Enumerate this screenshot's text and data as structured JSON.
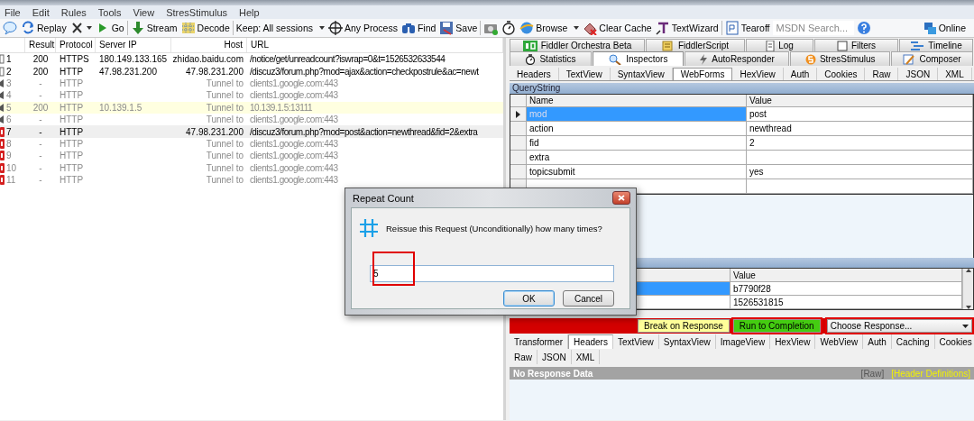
{
  "menu": [
    "File",
    "Edit",
    "Rules",
    "Tools",
    "View",
    "StresStimulus",
    "Help"
  ],
  "toolbar": [
    {
      "kind": "icon"
    },
    {
      "kind": "button",
      "label": "Replay"
    },
    {
      "kind": "icon-menu"
    },
    {
      "kind": "button",
      "label": "Go"
    },
    {
      "kind": "sep"
    },
    {
      "kind": "button",
      "label": "Stream"
    },
    {
      "kind": "button",
      "label": "Decode"
    },
    {
      "kind": "sep"
    },
    {
      "kind": "text-menu",
      "label": "Keep: All sessions"
    },
    {
      "kind": "button",
      "label": "Any Process"
    },
    {
      "kind": "button",
      "label": "Find"
    },
    {
      "kind": "button",
      "label": "Save"
    },
    {
      "kind": "sep"
    },
    {
      "kind": "icon"
    },
    {
      "kind": "icon"
    },
    {
      "kind": "menu",
      "label": "Browse"
    },
    {
      "kind": "button",
      "label": "Clear Cache"
    },
    {
      "kind": "button",
      "label": "TextWizard"
    },
    {
      "kind": "sep"
    },
    {
      "kind": "button",
      "label": "Tearoff"
    },
    {
      "kind": "search",
      "placeholder": "MSDN Search..."
    },
    {
      "kind": "icon"
    },
    {
      "kind": "status",
      "label": "Online"
    }
  ],
  "sessions": {
    "columns": [
      "Result",
      "Protocol",
      "Server IP",
      "Host",
      "URL"
    ],
    "rows": [
      {
        "num": "1",
        "result": "200",
        "protocol": "HTTPS",
        "server_ip": "180.149.133.165",
        "host": "zhidao.baidu.com",
        "url": "/notice/get/unreadcount?iswrap=0&t=1526532633544",
        "kind": "request",
        "breakpoint": false,
        "highlighted": false,
        "selected": false
      },
      {
        "num": "2",
        "result": "200",
        "protocol": "HTTP",
        "server_ip": "47.98.231.200",
        "host": "47.98.231.200",
        "url": "/discuz3/forum.php?mod=ajax&action=checkpostrule&ac=newt",
        "kind": "request",
        "breakpoint": false,
        "highlighted": false,
        "selected": false
      },
      {
        "num": "3",
        "result": "-",
        "protocol": "HTTP",
        "host": "Tunnel to",
        "url": "clients1.google.com:443",
        "kind": "tunnel",
        "breakpoint": false,
        "highlighted": false,
        "selected": false
      },
      {
        "num": "4",
        "result": "-",
        "protocol": "HTTP",
        "host": "Tunnel to",
        "url": "clients1.google.com:443",
        "kind": "tunnel",
        "breakpoint": false,
        "highlighted": false,
        "selected": false
      },
      {
        "num": "5",
        "result": "200",
        "protocol": "HTTP",
        "server_ip": "10.139.1.5",
        "host": "Tunnel to",
        "url": "10.139.1.5:13111",
        "kind": "tunnel",
        "breakpoint": false,
        "highlighted": true,
        "selected": false
      },
      {
        "num": "6",
        "result": "-",
        "protocol": "HTTP",
        "host": "Tunnel to",
        "url": "clients1.google.com:443",
        "kind": "tunnel",
        "breakpoint": false,
        "highlighted": false,
        "selected": false
      },
      {
        "num": "7",
        "result": "-",
        "protocol": "HTTP",
        "host": "47.98.231.200",
        "url": "/discuz3/forum.php?mod=post&action=newthread&fid=2&extra",
        "kind": "request",
        "breakpoint": true,
        "highlighted": false,
        "selected": true
      },
      {
        "num": "8",
        "result": "-",
        "protocol": "HTTP",
        "host": "Tunnel to",
        "url": "clients1.google.com:443",
        "kind": "tunnel",
        "breakpoint": true,
        "highlighted": false,
        "selected": false
      },
      {
        "num": "9",
        "result": "-",
        "protocol": "HTTP",
        "host": "Tunnel to",
        "url": "clients1.google.com:443",
        "kind": "tunnel",
        "breakpoint": true,
        "highlighted": false,
        "selected": false
      },
      {
        "num": "10",
        "result": "-",
        "protocol": "HTTP",
        "host": "Tunnel to",
        "url": "clients1.google.com:443",
        "kind": "tunnel",
        "breakpoint": true,
        "highlighted": false,
        "selected": false
      },
      {
        "num": "11",
        "result": "-",
        "protocol": "HTTP",
        "host": "Tunnel to",
        "url": "clients1.google.com:443",
        "kind": "tunnel",
        "breakpoint": true,
        "highlighted": false,
        "selected": false
      }
    ]
  },
  "right_tabs": [
    [
      {
        "label": "Fiddler Orchestra Beta",
        "selected": false
      },
      {
        "label": "FiddlerScript",
        "selected": false
      },
      {
        "label": "Log",
        "selected": false
      },
      {
        "label": "Filters",
        "selected": false
      },
      {
        "label": "Timeline",
        "selected": false
      }
    ],
    [
      {
        "label": "Statistics",
        "selected": false
      },
      {
        "label": "Inspectors",
        "selected": true
      },
      {
        "label": "AutoResponder",
        "selected": false
      },
      {
        "label": "StresStimulus",
        "selected": false
      },
      {
        "label": "Composer",
        "selected": false
      }
    ]
  ],
  "request_tabs": [
    {
      "label": "Headers",
      "selected": false
    },
    {
      "label": "TextView",
      "selected": false
    },
    {
      "label": "SyntaxView",
      "selected": false
    },
    {
      "label": "WebForms",
      "selected": true
    },
    {
      "label": "HexView",
      "selected": false
    },
    {
      "label": "Auth",
      "selected": false
    },
    {
      "label": "Cookies",
      "selected": false
    },
    {
      "label": "Raw",
      "selected": false
    },
    {
      "label": "JSON",
      "selected": false
    },
    {
      "label": "XML",
      "selected": false
    }
  ],
  "query_string": {
    "title": "QueryString",
    "columns": [
      "Name",
      "Value"
    ],
    "rows": [
      {
        "name": "mod",
        "value": "post",
        "selected": true
      },
      {
        "name": "action",
        "value": "newthread",
        "selected": false
      },
      {
        "name": "fid",
        "value": "2",
        "selected": false
      },
      {
        "name": "extra",
        "selected": false
      },
      {
        "name": "topicsubmit",
        "value": "yes",
        "selected": false
      }
    ]
  },
  "body_grid": {
    "columns": [
      "Value"
    ],
    "rows": [
      {
        "value": "b7790f28",
        "selected": true
      },
      {
        "value": "1526531815",
        "selected": false
      }
    ]
  },
  "breakpoint_bar": {
    "buttons": [
      {
        "label": "Break on Response",
        "kind": "break",
        "outlined": false
      },
      {
        "label": "Run to Completion",
        "kind": "run",
        "outlined": true
      }
    ],
    "dropdown": {
      "label": "Choose Response...",
      "outlined": true
    }
  },
  "response_tabs": [
    [
      {
        "label": "Transformer",
        "selected": false
      },
      {
        "label": "Headers",
        "selected": true
      },
      {
        "label": "TextView",
        "selected": false
      },
      {
        "label": "SyntaxView",
        "selected": false
      },
      {
        "label": "ImageView",
        "selected": false
      },
      {
        "label": "HexView",
        "selected": false
      },
      {
        "label": "WebView",
        "selected": false
      },
      {
        "label": "Auth",
        "selected": false
      },
      {
        "label": "Caching",
        "selected": false
      },
      {
        "label": "Cookies",
        "selected": false
      }
    ],
    [
      {
        "label": "Raw",
        "selected": false
      },
      {
        "label": "JSON",
        "selected": false
      },
      {
        "label": "XML",
        "selected": false
      }
    ]
  ],
  "response_bar": {
    "title": "No Response Data",
    "links": [
      "[Raw]",
      "[Header Definitions]"
    ]
  },
  "dialog": {
    "title": "Repeat Count",
    "message": "Reissue this Request (Unconditionally) how many times?",
    "value": "5",
    "input_outlined": true,
    "buttons": [
      {
        "label": "OK",
        "default": true
      },
      {
        "label": "Cancel",
        "default": false
      }
    ]
  }
}
